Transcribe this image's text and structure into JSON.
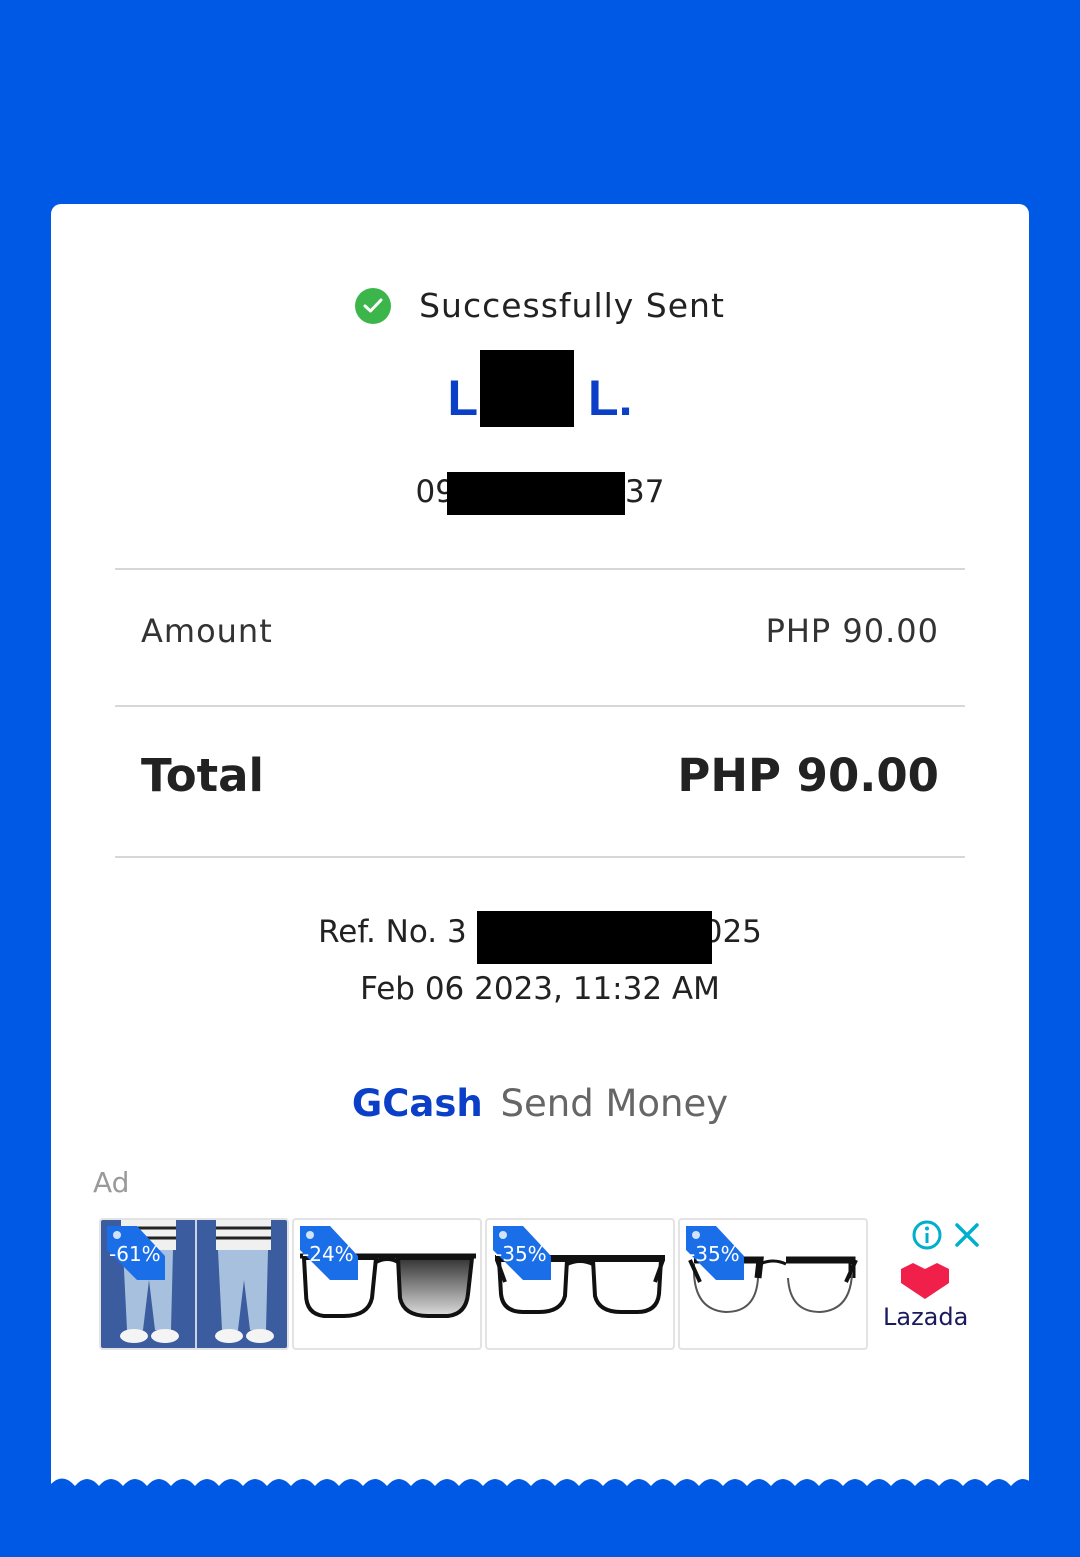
{
  "status": {
    "text": "Successfully Sent",
    "icon": "check-circle-icon"
  },
  "recipient": {
    "name_start": "L",
    "name_end": "L.",
    "phone_start": "09",
    "phone_end": "37"
  },
  "amount": {
    "label": "Amount",
    "value": "PHP 90.00"
  },
  "total": {
    "label": "Total",
    "value": "PHP 90.00"
  },
  "reference": {
    "prefix": "Ref. No. 3",
    "suffix": "025"
  },
  "date": "Feb 06 2023, 11:32 AM",
  "brand": {
    "gcash": "GCash",
    "service": "Send Money"
  },
  "ad": {
    "label": "Ad",
    "products": [
      {
        "discount": "-61%"
      },
      {
        "discount": "-24%"
      },
      {
        "discount": "-35%"
      },
      {
        "discount": "-35%"
      }
    ],
    "advertiser": "Lazada"
  },
  "colors": {
    "background": "#0059e4",
    "accent": "#0b3fc7",
    "success": "#3cb54a",
    "tag": "#1a6fe8"
  }
}
